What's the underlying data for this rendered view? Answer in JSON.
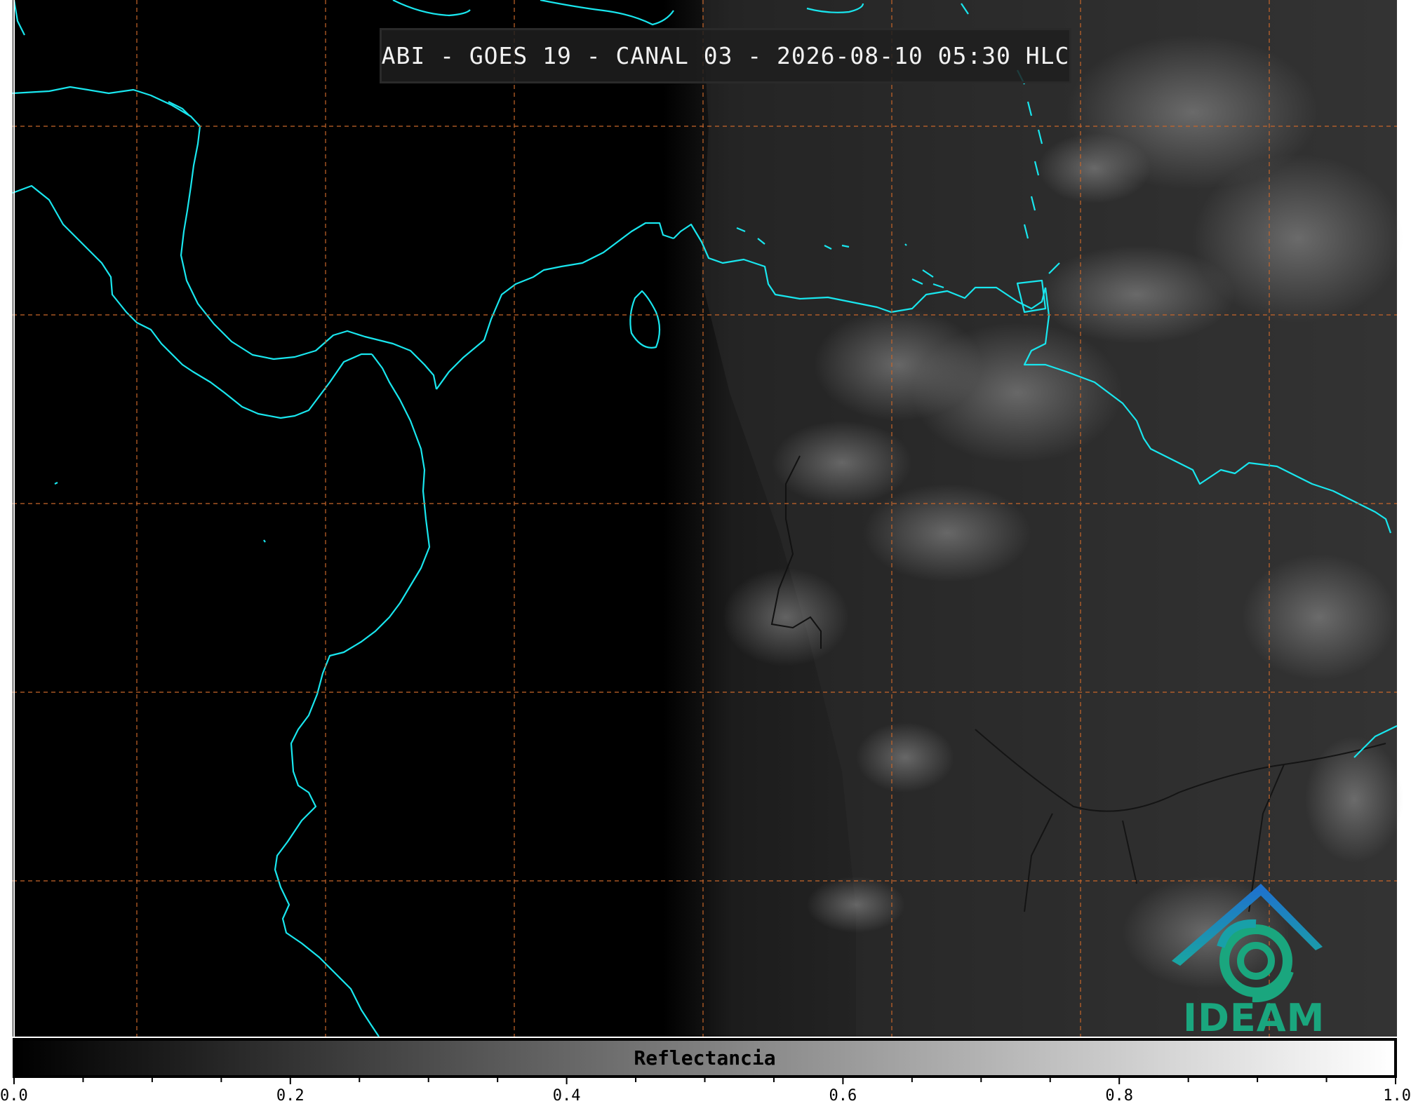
{
  "title": "ABI - GOES 19 - CANAL 03 - 2026-08-10 05:30 HLC",
  "logo": {
    "text": "IDEAM",
    "icon": "ideam-swirl-mountain-logo"
  },
  "colorbar": {
    "label": "Reflectancia",
    "min": 0.0,
    "max": 1.0,
    "tick_labels": [
      "0.0",
      "0.2",
      "0.4",
      "0.6",
      "0.8",
      "1.0"
    ],
    "minor_step": 0.05,
    "colormap": [
      "#000000",
      "#ffffff"
    ]
  },
  "colors": {
    "coastline": "#19e6ee",
    "gridlines": "#c8662a",
    "background": "#000000"
  }
}
